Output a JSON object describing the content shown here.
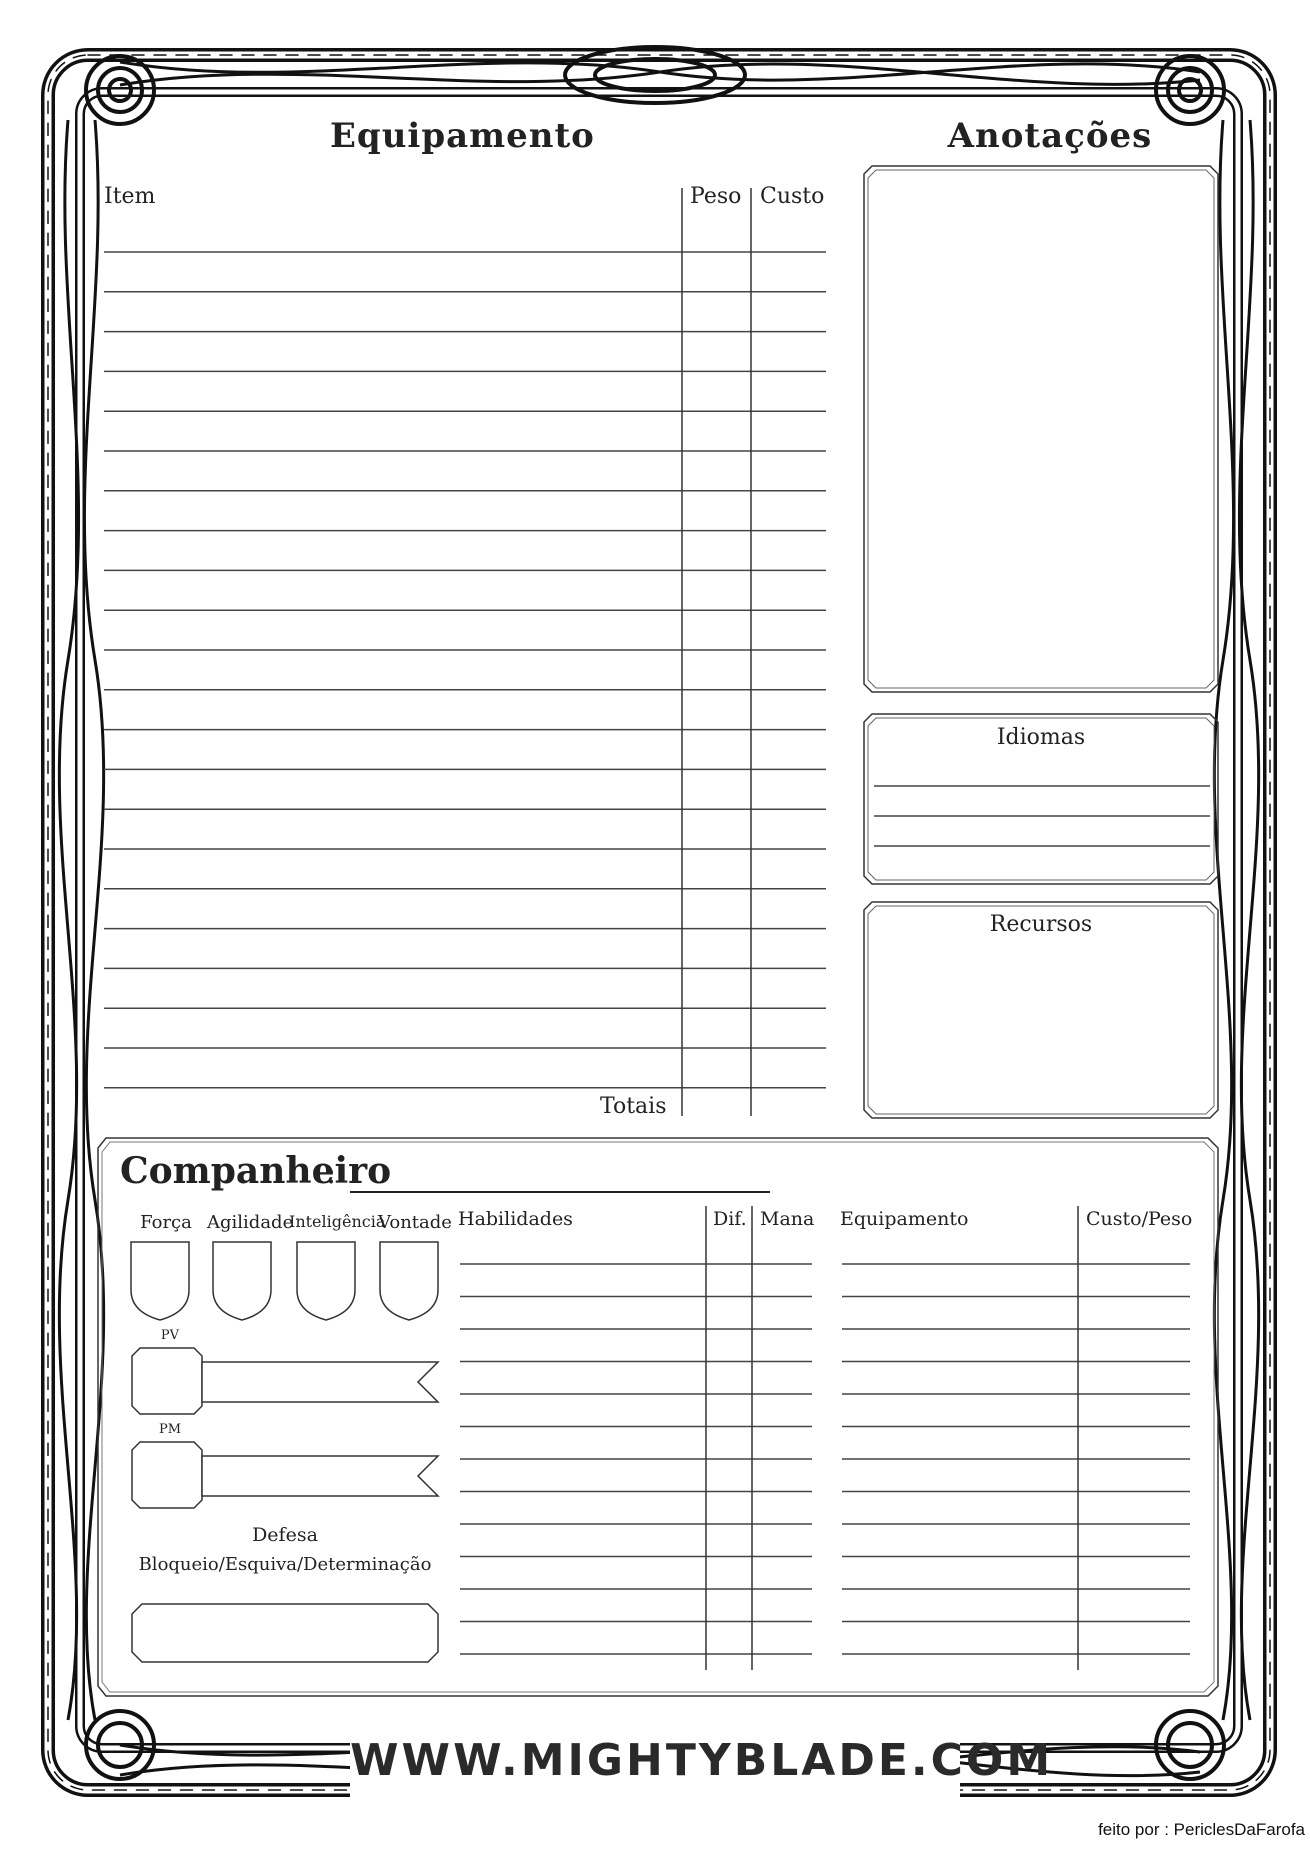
{
  "equipment": {
    "title": "Equipamento",
    "col_item": "Item",
    "col_weight": "Peso",
    "col_cost": "Custo",
    "totals_label": "Totais",
    "row_count": 22
  },
  "notes": {
    "title": "Anotações"
  },
  "languages": {
    "title": "Idiomas",
    "line_count": 3
  },
  "resources": {
    "title": "Recursos"
  },
  "companion": {
    "title": "Companheiro",
    "separator": ":",
    "attributes": [
      "Força",
      "Agilidade",
      "Inteligência",
      "Vontade"
    ],
    "pv_label": "PV",
    "pm_label": "PM",
    "defense_label": "Defesa",
    "defense_types": "Bloqueio/Esquiva/Determinação",
    "skills": {
      "col_name": "Habilidades",
      "col_dif": "Dif.",
      "col_mana": "Mana",
      "row_count": 13
    },
    "gear": {
      "col_name": "Equipamento",
      "col_cost": "Custo/Peso",
      "row_count": 13
    }
  },
  "footer": {
    "website": "WWW.MIGHTYBLADE.COM",
    "credit": "feito por : PericlesDaFarofa"
  },
  "colors": {
    "ink": "#222222",
    "rule": "#555555",
    "paper": "#ffffff"
  }
}
